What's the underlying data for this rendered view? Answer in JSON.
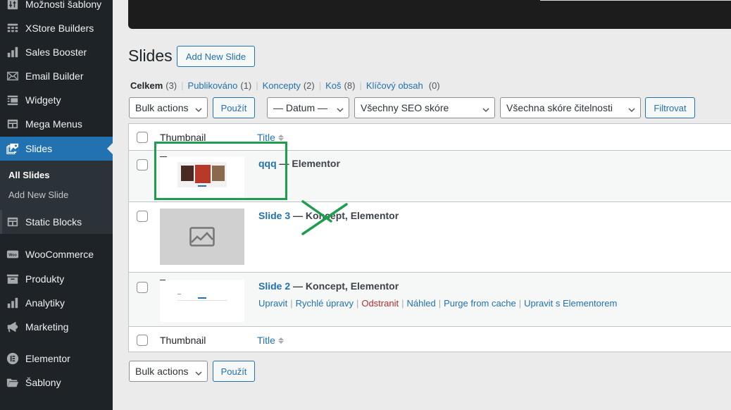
{
  "sidebar": {
    "items": [
      {
        "label": "Možnosti šablony",
        "icon": "sliders-icon"
      },
      {
        "label": "XStore Builders",
        "icon": "layout-icon"
      },
      {
        "label": "Sales Booster",
        "icon": "bar-chart-icon"
      },
      {
        "label": "Email Builder",
        "icon": "envelope-icon"
      },
      {
        "label": "Widgety",
        "icon": "widgets-icon"
      },
      {
        "label": "Mega Menus",
        "icon": "mega-menu-icon"
      },
      {
        "label": "Slides",
        "icon": "images-icon",
        "current": true
      },
      {
        "label": "Static Blocks",
        "icon": "blocks-icon"
      },
      {
        "label": "WooCommerce",
        "icon": "woo-icon"
      },
      {
        "label": "Produkty",
        "icon": "archive-icon"
      },
      {
        "label": "Analytiky",
        "icon": "bar-chart-icon"
      },
      {
        "label": "Marketing",
        "icon": "megaphone-icon"
      },
      {
        "label": "Elementor",
        "icon": "elementor-icon"
      },
      {
        "label": "Šablony",
        "icon": "folder-icon"
      }
    ],
    "submenu": {
      "all": "All Slides",
      "add_new": "Add New Slide"
    }
  },
  "header": {
    "title": "Slides",
    "add_new_label": "Add New Slide"
  },
  "views": {
    "all": {
      "label": "Celkem",
      "count": "(3)"
    },
    "published": {
      "label": "Publikováno",
      "count": "(1)"
    },
    "drafts": {
      "label": "Koncepty",
      "count": "(2)"
    },
    "trash": {
      "label": "Koš",
      "count": "(8)"
    },
    "cornerstone": {
      "label": "Klíčový obsah",
      "count": "(0)"
    }
  },
  "filters": {
    "bulk_actions": "Bulk actions",
    "apply": "Použít",
    "date": "— Datum —",
    "seo": "Všechny SEO skóre",
    "readability": "Všechna skóre čitelnosti",
    "filter": "Filtrovat"
  },
  "table": {
    "columns": {
      "thumbnail": "Thumbnail",
      "title": "Title"
    },
    "rows": [
      {
        "title": "qqq",
        "state": " — Elementor",
        "thumb": "slide-preview"
      },
      {
        "title": "Slide 3",
        "state": " — Koncept, Elementor",
        "thumb": "placeholder"
      },
      {
        "title": "Slide 2",
        "state": " — Koncept, Elementor",
        "thumb": "blank-preview",
        "actions": [
          "Upravit",
          "Rychlé úpravy",
          "Odstranit",
          "Náhled",
          "Purge from cache",
          "Upravit s Elementorem"
        ]
      }
    ]
  },
  "footer": {
    "bulk_actions": "Bulk actions",
    "apply": "Použít"
  },
  "colors": {
    "accent": "#2271b1",
    "sidebar_bg": "#1d2327",
    "danger": "#b32d2e",
    "annotation": "#1f9d4f"
  }
}
